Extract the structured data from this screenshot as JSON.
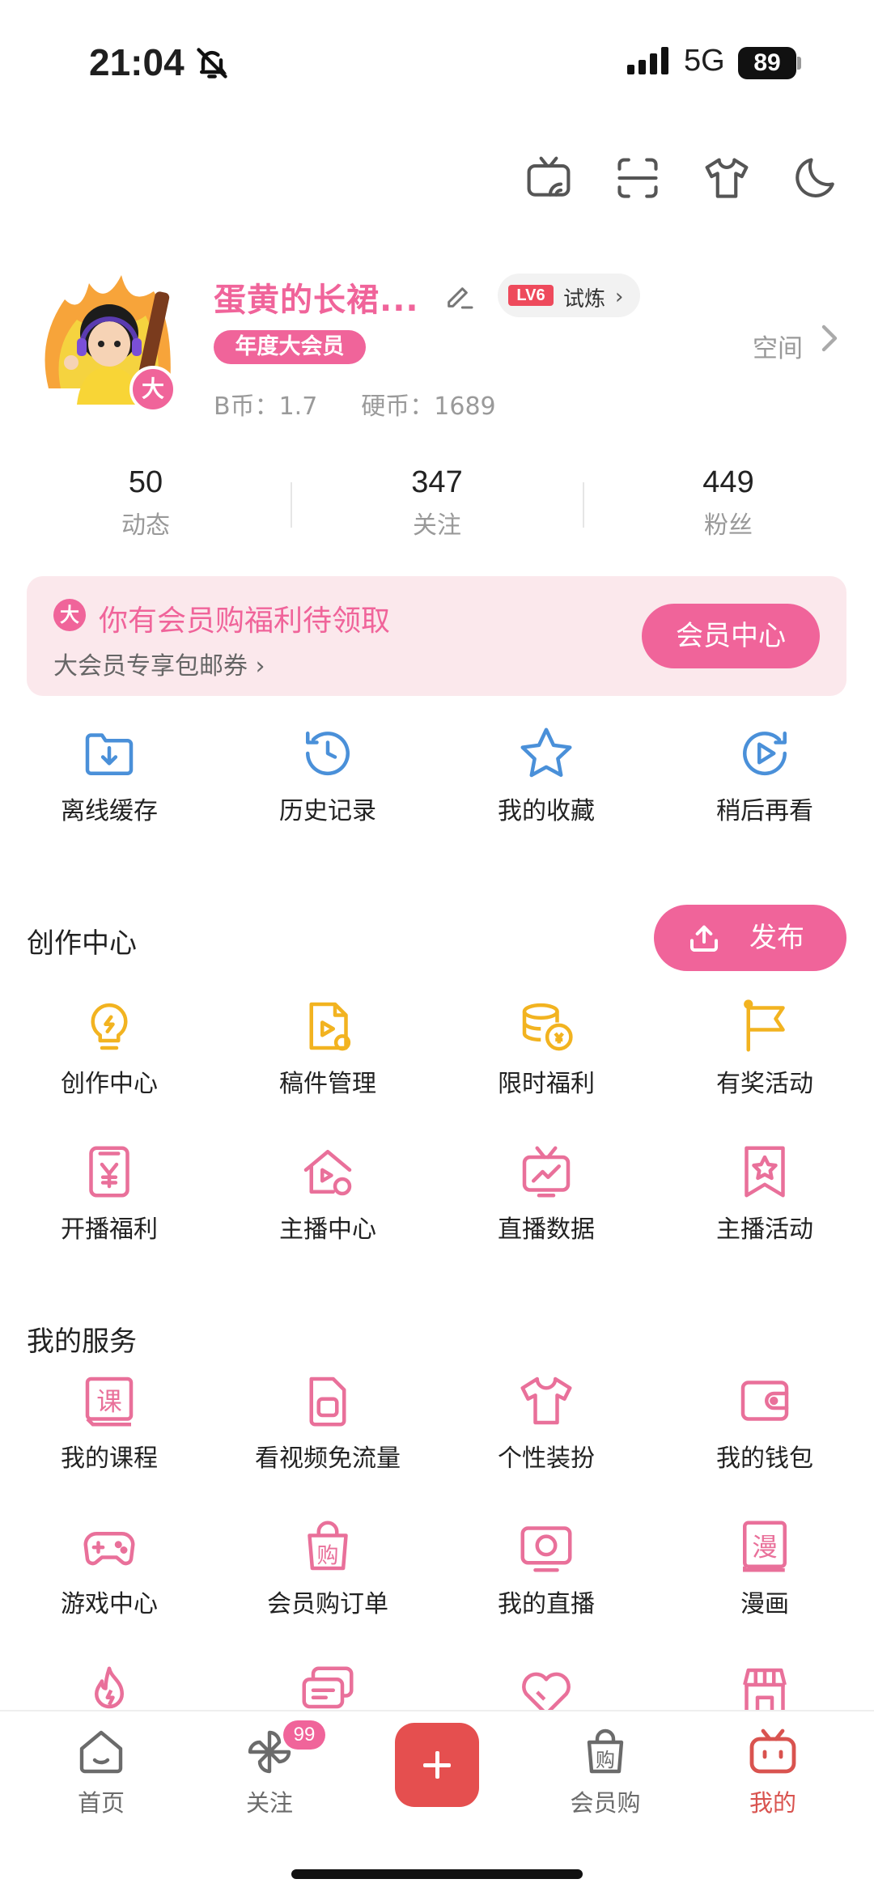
{
  "status_bar": {
    "time": "21:04",
    "network": "5G",
    "battery": "89"
  },
  "profile": {
    "username": "蛋黄的长裙...",
    "level": "LV6",
    "level_tag": "试炼",
    "vip_tag": "年度大会员",
    "avatar_badge": "大",
    "space_link": "空间",
    "b_coins": "B币：1.7",
    "hard_coins": "硬币：1689"
  },
  "stats": [
    {
      "value": "50",
      "label": "动态"
    },
    {
      "value": "347",
      "label": "关注"
    },
    {
      "value": "449",
      "label": "粉丝"
    }
  ],
  "vip_banner": {
    "icon_text": "大",
    "title": "你有会员购福利待领取",
    "subtitle": "大会员专享包邮券",
    "button": "会员中心"
  },
  "quick_actions": [
    {
      "label": "离线缓存",
      "icon": "download-folder-icon"
    },
    {
      "label": "历史记录",
      "icon": "history-clock-icon"
    },
    {
      "label": "我的收藏",
      "icon": "star-icon"
    },
    {
      "label": "稍后再看",
      "icon": "watch-later-icon"
    }
  ],
  "creation": {
    "title": "创作中心",
    "publish_button": "发布",
    "items": [
      {
        "label": "创作中心",
        "icon": "lightbulb-icon"
      },
      {
        "label": "稿件管理",
        "icon": "manuscript-icon"
      },
      {
        "label": "限时福利",
        "icon": "coins-icon"
      },
      {
        "label": "有奖活动",
        "icon": "flag-icon"
      },
      {
        "label": "开播福利",
        "icon": "yen-card-icon"
      },
      {
        "label": "主播中心",
        "icon": "streamer-home-icon"
      },
      {
        "label": "直播数据",
        "icon": "live-data-tv-icon"
      },
      {
        "label": "主播活动",
        "icon": "bookmark-star-icon"
      }
    ]
  },
  "services": {
    "title": "我的服务",
    "items": [
      {
        "label": "我的课程",
        "icon": "course-book-icon",
        "glyph": "课"
      },
      {
        "label": "看视频免流量",
        "icon": "sim-card-icon"
      },
      {
        "label": "个性装扮",
        "icon": "tshirt-icon"
      },
      {
        "label": "我的钱包",
        "icon": "wallet-icon"
      },
      {
        "label": "游戏中心",
        "icon": "gamepad-icon"
      },
      {
        "label": "会员购订单",
        "icon": "shopping-bag-icon",
        "glyph": "购"
      },
      {
        "label": "我的直播",
        "icon": "live-tv-icon"
      },
      {
        "label": "漫画",
        "icon": "comic-book-icon",
        "glyph": "漫"
      }
    ]
  },
  "bottom_nav": [
    {
      "label": "首页",
      "icon": "home-icon"
    },
    {
      "label": "关注",
      "icon": "pinwheel-icon",
      "badge": "99"
    },
    {
      "label": "",
      "icon": "plus-icon"
    },
    {
      "label": "会员购",
      "icon": "shopping-bag-icon",
      "glyph": "购"
    },
    {
      "label": "我的",
      "icon": "bilibili-tv-icon"
    }
  ],
  "colors": {
    "pink": "#f0649a",
    "blue": "#4a90d9",
    "gold": "#f2b320",
    "nav_active": "#d9534f"
  }
}
